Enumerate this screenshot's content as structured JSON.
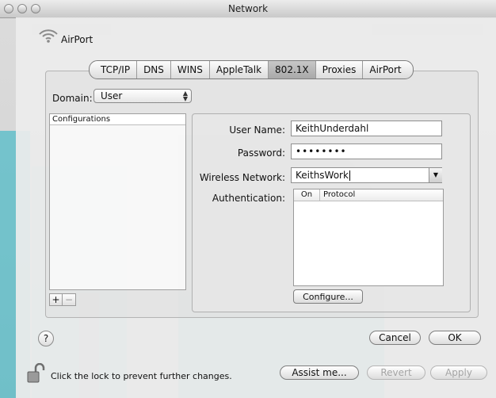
{
  "window": {
    "title": "Network"
  },
  "sheet": {
    "service_name": "AirPort"
  },
  "tabs": [
    {
      "label": "TCP/IP",
      "selected": false
    },
    {
      "label": "DNS",
      "selected": false
    },
    {
      "label": "WINS",
      "selected": false
    },
    {
      "label": "AppleTalk",
      "selected": false
    },
    {
      "label": "802.1X",
      "selected": true
    },
    {
      "label": "Proxies",
      "selected": false
    },
    {
      "label": "AirPort",
      "selected": false
    }
  ],
  "domain": {
    "label": "Domain:",
    "value": "User"
  },
  "configurations": {
    "header": "Configurations",
    "add": "+",
    "remove": "−"
  },
  "form": {
    "username_label": "User Name:",
    "username_value": "KeithUnderdahl",
    "password_label": "Password:",
    "password_value": "••••••••",
    "network_label": "Wireless Network:",
    "network_value": "KeithsWork",
    "auth_label": "Authentication:",
    "auth_columns": [
      "On",
      "Protocol"
    ],
    "configure_button": "Configure..."
  },
  "buttons": {
    "help": "?",
    "cancel": "Cancel",
    "ok": "OK"
  },
  "footer": {
    "lock_text": "Click the lock to prevent further changes.",
    "assist": "Assist me...",
    "revert": "Revert",
    "apply": "Apply"
  }
}
